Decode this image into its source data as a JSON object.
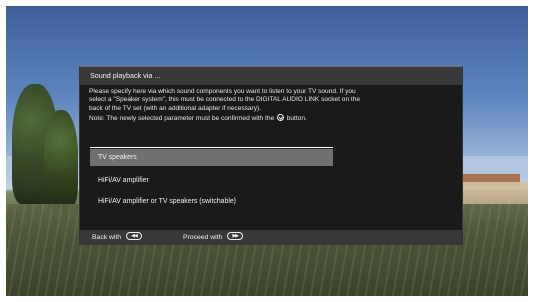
{
  "dialog": {
    "title": "Sound playback via ...",
    "description_lines": [
      "Please specify here via which sound components you want to listen to your TV sound. If you",
      "select a \"Speaker system\", this must be connected to the DIGITAL AUDIO LINK socket on the",
      "back of the TV set (with an additional adapter if necessary)."
    ],
    "note_before_icon": "Note: The newly selected parameter must be confirmed with the",
    "note_after_icon": "button.",
    "options": [
      {
        "label": "TV speakers",
        "selected": true
      },
      {
        "label": "HiFi/AV amplifier",
        "selected": false
      },
      {
        "label": "HiFi/AV amplifier or TV speakers (switchable)",
        "selected": false
      }
    ],
    "footer": {
      "back_label": "Back with",
      "proceed_label": "Proceed with",
      "back_icon": "rewind-button-icon",
      "proceed_icon": "forward-button-icon"
    }
  },
  "colors": {
    "dialog_bg": "#1a1a1a",
    "titlebar_bg": "#383838",
    "selected_bg": "#707070",
    "text": "#f0f0f0"
  }
}
